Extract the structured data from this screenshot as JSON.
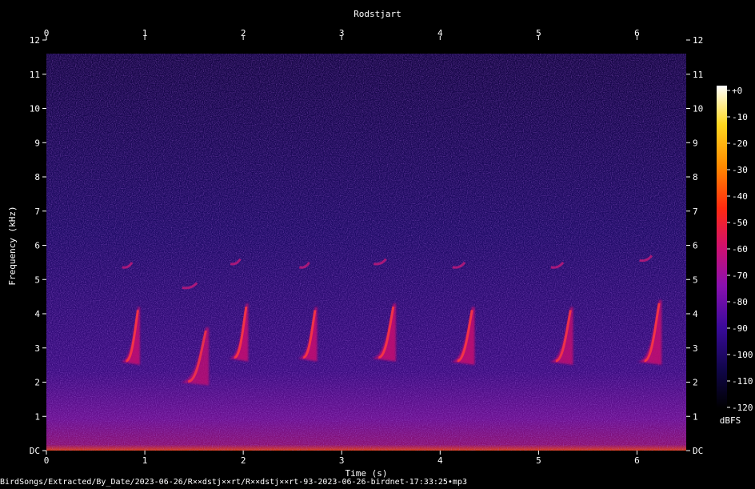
{
  "chart_data": {
    "type": "heatmap",
    "title": "Rodstjart",
    "xlabel": "Time (s)",
    "ylabel": "Frequency (kHz)",
    "x_ticks": [
      "0",
      "1",
      "2",
      "3",
      "4",
      "5",
      "6"
    ],
    "y_ticks": [
      "DC",
      "1",
      "2",
      "3",
      "4",
      "5",
      "6",
      "7",
      "8",
      "9",
      "10",
      "11",
      "12"
    ],
    "xlim": [
      0,
      6.5
    ],
    "ylim": [
      0,
      12
    ],
    "colorbar": {
      "label": "dBFS",
      "ticks": [
        "+0",
        "-10",
        "-20",
        "-30",
        "-40",
        "-50",
        "-60",
        "-70",
        "-80",
        "-90",
        "-100",
        "-110",
        "-120"
      ],
      "range": [
        -120,
        0
      ]
    },
    "calls": [
      {
        "start": 0.75,
        "end": 0.95,
        "f_low": 2.6,
        "f_high": 4.2,
        "intensity": 0.85
      },
      {
        "start": 1.35,
        "end": 1.65,
        "f_low": 2.0,
        "f_high": 3.6,
        "intensity": 0.75
      },
      {
        "start": 1.85,
        "end": 2.05,
        "f_low": 2.7,
        "f_high": 4.3,
        "intensity": 0.85
      },
      {
        "start": 2.55,
        "end": 2.75,
        "f_low": 2.7,
        "f_high": 4.2,
        "intensity": 0.85
      },
      {
        "start": 3.3,
        "end": 3.55,
        "f_low": 2.7,
        "f_high": 4.3,
        "intensity": 0.85
      },
      {
        "start": 4.1,
        "end": 4.35,
        "f_low": 2.6,
        "f_high": 4.2,
        "intensity": 0.85
      },
      {
        "start": 5.1,
        "end": 5.35,
        "f_low": 2.6,
        "f_high": 4.2,
        "intensity": 0.8
      },
      {
        "start": 6.0,
        "end": 6.25,
        "f_low": 2.6,
        "f_high": 4.4,
        "intensity": 0.85
      }
    ],
    "colors": {
      "background": "#000000",
      "noise": "#1c0a5a",
      "colormap": [
        "#000000",
        "#10064a",
        "#3a0a9a",
        "#8a10b0",
        "#d0106e",
        "#ff2a10",
        "#ff8a00",
        "#ffd820",
        "#ffffff"
      ]
    }
  },
  "footer": {
    "filename": "BirdSongs/Extracted/By_Date/2023-06-26/R××dstj××rt/R××dstj××rt-93-2023-06-26-birdnet-17:33:25•mp3"
  }
}
